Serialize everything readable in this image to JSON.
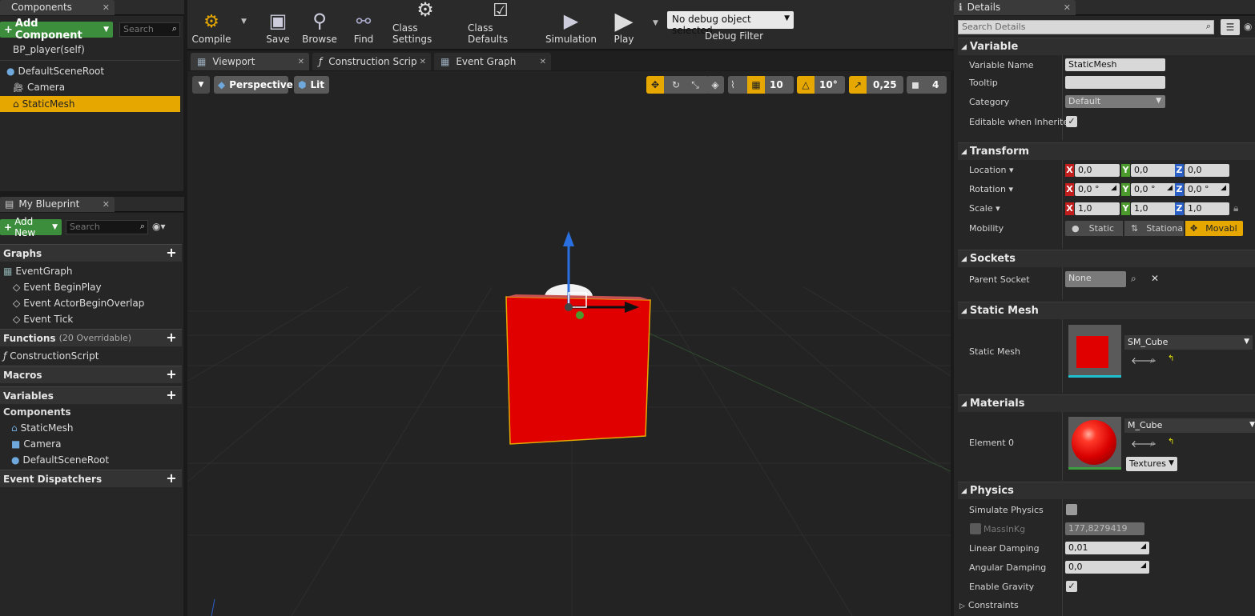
{
  "components_panel": {
    "title": "Components",
    "add_component": "Add Component",
    "search_placeholder": "Search",
    "self": "BP_player(self)",
    "tree": [
      "DefaultSceneRoot",
      "Camera",
      "StaticMesh"
    ]
  },
  "my_blueprint": {
    "title": "My Blueprint",
    "add_new": "Add New",
    "search_placeholder": "Search",
    "graphs_label": "Graphs",
    "event_graph": "EventGraph",
    "events": [
      "Event BeginPlay",
      "Event ActorBeginOverlap",
      "Event Tick"
    ],
    "functions_label": "Functions",
    "functions_count": "(20 Overridable)",
    "construction_script": "ConstructionScript",
    "macros_label": "Macros",
    "variables_label": "Variables",
    "components_label": "Components",
    "component_vars": [
      "StaticMesh",
      "Camera",
      "DefaultSceneRoot"
    ],
    "event_dispatchers_label": "Event Dispatchers"
  },
  "toolbar": {
    "compile": "Compile",
    "save": "Save",
    "browse": "Browse",
    "find": "Find",
    "class_settings": "Class Settings",
    "class_defaults": "Class Defaults",
    "simulation": "Simulation",
    "play": "Play",
    "debug_object": "No debug object selected",
    "debug_filter": "Debug Filter"
  },
  "editor_tabs": [
    "Viewport",
    "Construction Scrip",
    "Event Graph"
  ],
  "viewport": {
    "perspective": "Perspective",
    "lit": "Lit",
    "grid_snap": "10",
    "rot_snap": "10°",
    "scale_snap": "0,25",
    "camera_speed": "4"
  },
  "details": {
    "title": "Details",
    "search_placeholder": "Search Details",
    "variable_section": "Variable",
    "variable_name_label": "Variable Name",
    "variable_name": "StaticMesh",
    "tooltip_label": "Tooltip",
    "category_label": "Category",
    "category": "Default",
    "editable_label": "Editable when Inherited",
    "transform_section": "Transform",
    "location_label": "Location",
    "rotation_label": "Rotation",
    "scale_label": "Scale",
    "mobility_label": "Mobility",
    "location": [
      "0,0",
      "0,0",
      "0,0"
    ],
    "rotation": [
      "0,0 °",
      "0,0 °",
      "0,0 °"
    ],
    "scale": [
      "1,0",
      "1,0",
      "1,0"
    ],
    "axes": [
      "X",
      "Y",
      "Z"
    ],
    "mobility_options": [
      "Static",
      "Stationa",
      "Movabl"
    ],
    "sockets_section": "Sockets",
    "parent_socket_label": "Parent Socket",
    "parent_socket": "None",
    "static_mesh_section": "Static Mesh",
    "static_mesh_label": "Static Mesh",
    "static_mesh_value": "SM_Cube",
    "materials_section": "Materials",
    "element0_label": "Element 0",
    "material_value": "M_Cube",
    "textures_label": "Textures",
    "physics_section": "Physics",
    "simulate_physics_label": "Simulate Physics",
    "mass_label": "MassInKg",
    "mass_value": "177,8279419",
    "linear_damping_label": "Linear Damping",
    "linear_damping": "0,01",
    "angular_damping_label": "Angular Damping",
    "angular_damping": "0,0",
    "enable_gravity_label": "Enable Gravity",
    "constraints_label": "Constraints"
  },
  "colors": {
    "selection": "#e6a800",
    "green_button": "#3c8d3c",
    "cube": "#e00000",
    "axis_x": "#c21d1d",
    "axis_y": "#4a9b2c",
    "axis_z": "#2a5fc8"
  }
}
